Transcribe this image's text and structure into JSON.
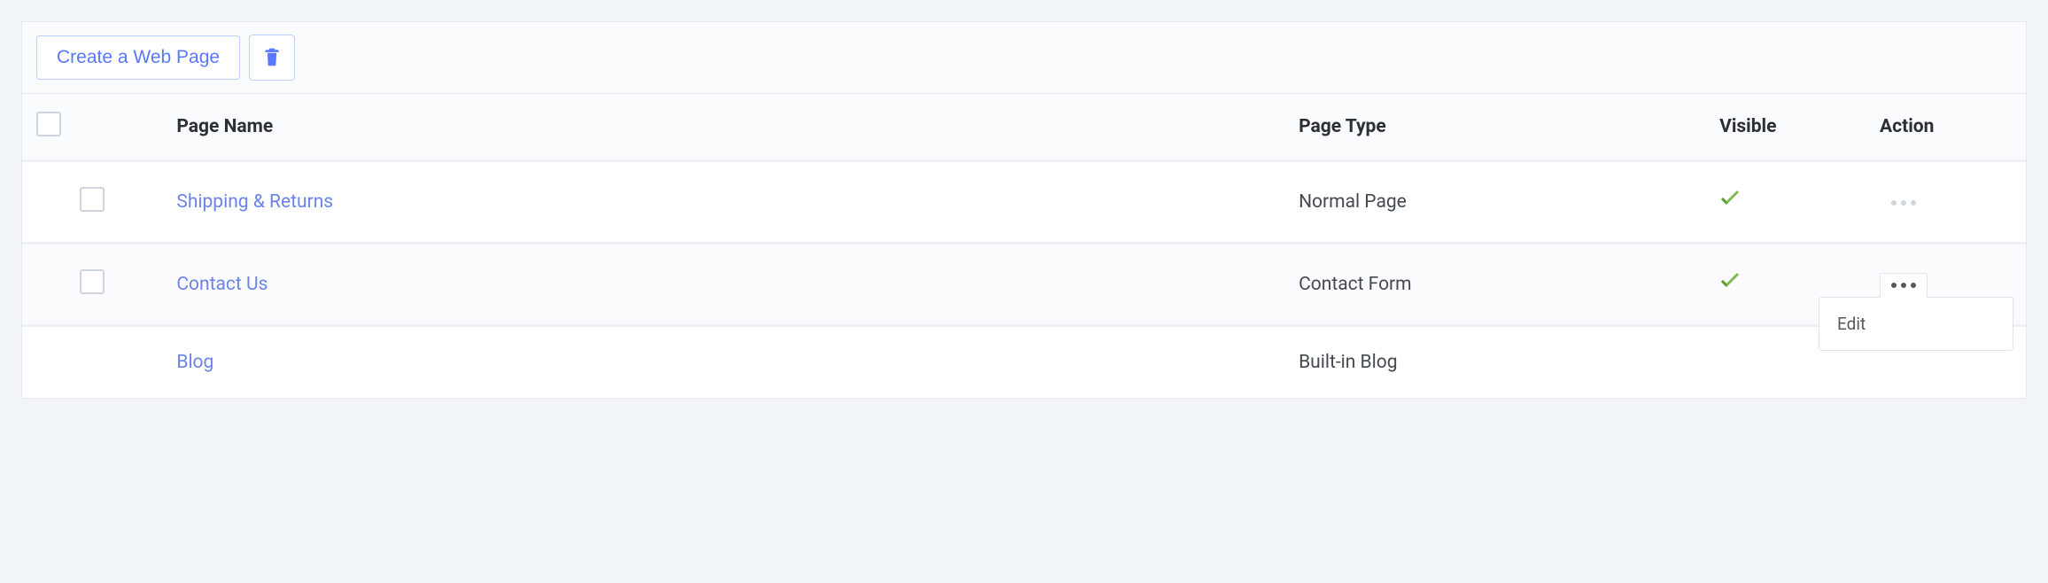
{
  "toolbar": {
    "create_label": "Create a Web Page"
  },
  "columns": {
    "name": "Page Name",
    "type": "Page Type",
    "visible": "Visible",
    "action": "Action"
  },
  "rows": [
    {
      "name": "Shipping & Returns",
      "type": "Normal Page",
      "visible": true,
      "has_checkbox": true,
      "menu_open": false
    },
    {
      "name": "Contact Us",
      "type": "Contact Form",
      "visible": true,
      "has_checkbox": true,
      "menu_open": true
    },
    {
      "name": "Blog",
      "type": "Built-in Blog",
      "visible": false,
      "has_checkbox": false,
      "menu_open": false
    }
  ],
  "action_menu": {
    "edit": "Edit"
  }
}
